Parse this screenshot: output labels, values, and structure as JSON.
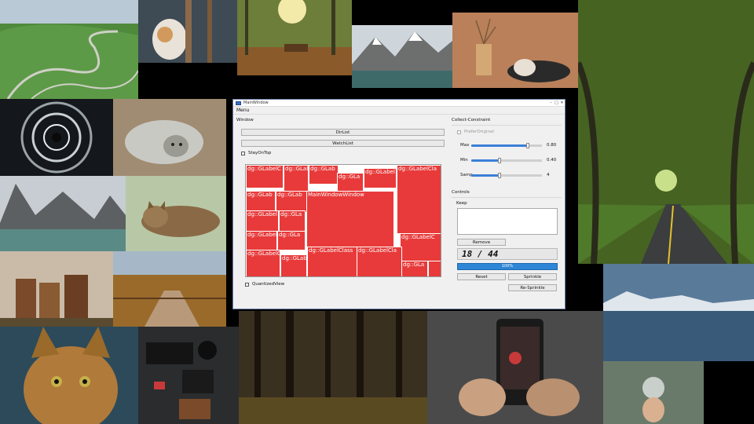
{
  "desktop": {
    "photos": [
      "mountain-road",
      "cat-behind-fence",
      "forest-bench",
      "mountain-lake",
      "sleeping-cat-flowers",
      "oak-tree-road",
      "tunnel-lights",
      "cat-lying-grey",
      "lake-mountains",
      "tabby-cat-sleeping",
      "log-stumps",
      "wooden-bridge-autumn",
      "cat-closeup",
      "camera-gear",
      "dark-forest",
      "phone-photo",
      "blue-lake",
      "glass-ball-hand"
    ]
  },
  "window": {
    "title": "MainWindow",
    "menu": "Menu",
    "window_section": "Window",
    "dirlist": "DirList",
    "watchlist": "WatchList",
    "stay_on_top": "StayOnTop",
    "quantized_view": "QuantizedView",
    "collect_section": "Collect-Constraint",
    "prefer_original": "PreferOriginal",
    "max_label": "Max",
    "max_value": "0.80",
    "min_label": "Min",
    "min_value": "0.40",
    "samp_label": "Samp",
    "samp_value": "4",
    "controls_section": "Controls",
    "keep": "Keep",
    "remove": "Remove",
    "counter": "18 / 44",
    "progress": "100%",
    "progress_value": 1.0,
    "reset": "Reset",
    "sprinkle": "Sprinkle",
    "resprinkle": "Re-Sprinkle"
  },
  "sliders": {
    "max": 0.8,
    "min": 0.4,
    "samp": 0.4
  },
  "tiles": {
    "t1": "dg::GLabelC",
    "t2": "dg::GLabe",
    "t3": "dg::GLab",
    "t4": "dg::GLa",
    "t5": "dg::GLabel",
    "t6": "dg::GLabelCla",
    "t7": "dg::GLab",
    "t8": "dg::GLab",
    "t9": "MainWindowWindow",
    "t10": "dg::GLabel",
    "t11": "dg::GLa",
    "t12": "dg::GLabel",
    "t13": "dg::GLa",
    "t14": "dg::GLabelC",
    "t15": "dg::GLabelC",
    "t16": "dg::GLabelClass",
    "t17": "dg::GLabelCla",
    "t18": "dg::GLab",
    "t19": "dg::GLa"
  },
  "colors": {
    "tile": "#e83a3a",
    "progress": "#2f86d6",
    "slider": "#3b7fd8"
  }
}
